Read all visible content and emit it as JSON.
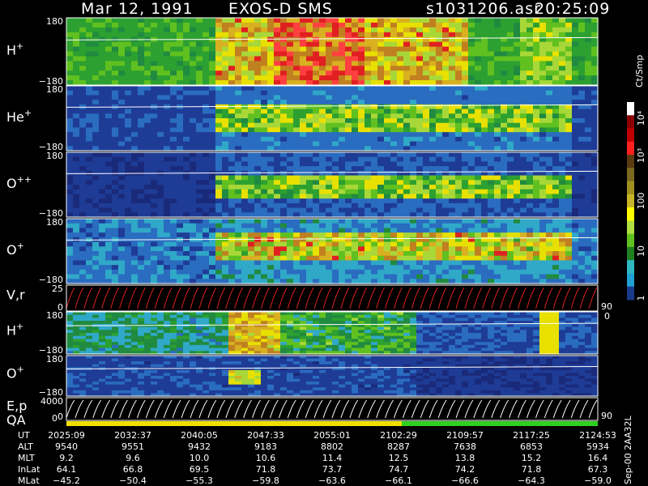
{
  "header": {
    "date": "Mar 12, 1991",
    "mission": "EXOS-D SMS",
    "file": "s1031206.asr",
    "time": "20:25:09"
  },
  "colorbar": {
    "unit": "Ct/Smp",
    "tick_labels": [
      "10⁴",
      "10³",
      "100",
      "10",
      "1"
    ],
    "colors": [
      "#ffffff",
      "#8b0000",
      "#c00000",
      "#ff2020",
      "#5a3a10",
      "#7a6a20",
      "#a09020",
      "#c8b428",
      "#ffff00",
      "#b0e040",
      "#60c020",
      "#208020",
      "#30b8c0",
      "#20a0d0",
      "#1a3a8a"
    ]
  },
  "panels": [
    {
      "id": "H+",
      "base": "H",
      "sup": "+",
      "ytop": "180",
      "ybot": "−180",
      "kind": "spec"
    },
    {
      "id": "He+",
      "base": "He",
      "sup": "+",
      "ytop": "180",
      "ybot": "−180",
      "kind": "spec"
    },
    {
      "id": "O++",
      "base": "O",
      "sup": "++",
      "ytop": "180",
      "ybot": "−180",
      "kind": "spec"
    },
    {
      "id": "O+",
      "base": "O",
      "sup": "+",
      "ytop": "180",
      "ybot": "−180",
      "kind": "spec"
    },
    {
      "id": "Vr",
      "base": "V,r",
      "sup": "",
      "ytop": "25",
      "ybot": "0",
      "kind": "line",
      "right_top": "90",
      "right_bot": "0"
    },
    {
      "id": "H+2",
      "base": "H",
      "sup": "+",
      "ytop": "180",
      "ybot": "−180",
      "kind": "spec"
    },
    {
      "id": "O+2",
      "base": "O",
      "sup": "+",
      "ytop": "180",
      "ybot": "−180",
      "kind": "spec"
    },
    {
      "id": "Ep",
      "base": "E,p",
      "sup": "",
      "ytop": "4000",
      "ybot": "0",
      "kind": "line",
      "right_top": "90",
      "right_bot": ""
    }
  ],
  "qa_label": "QA",
  "ephemeris": {
    "rows": [
      {
        "name": "UT",
        "values": [
          "2025:09",
          "2032:37",
          "2040:05",
          "2047:33",
          "2055:01",
          "2102:29",
          "2109:57",
          "2117:25",
          "2124:53"
        ]
      },
      {
        "name": "ALT",
        "values": [
          "9540",
          "9551",
          "9432",
          "9183",
          "8802",
          "8287",
          "7638",
          "6853",
          "5934"
        ]
      },
      {
        "name": "MLT",
        "values": [
          "9.2",
          "9.6",
          "10.0",
          "10.6",
          "11.4",
          "12.5",
          "13.8",
          "15.2",
          "16.4"
        ]
      },
      {
        "name": "InLat",
        "values": [
          "64.1",
          "66.8",
          "69.5",
          "71.8",
          "73.7",
          "74.7",
          "74.2",
          "71.8",
          "67.3"
        ]
      },
      {
        "name": "MLat",
        "values": [
          "−45.2",
          "−50.4",
          "−55.3",
          "−59.8",
          "−63.6",
          "−66.1",
          "−66.6",
          "−64.3",
          "−59.0"
        ]
      }
    ]
  },
  "footer_note": "Sep-00 2AA32L",
  "chart_data": {
    "type": "heatmap",
    "title": "Mar 12, 1991   EXOS-D SMS",
    "x_ticks_UT": [
      "2025:09",
      "2032:37",
      "2040:05",
      "2047:33",
      "2055:01",
      "2102:29",
      "2109:57",
      "2117:25",
      "2124:53"
    ],
    "y_range_spectra": [
      -180,
      180
    ],
    "colorbar_range": [
      1,
      10000
    ],
    "colorbar_scale": "log",
    "colorbar_unit": "Ct/Smp",
    "panels": [
      "H+",
      "He+",
      "O++",
      "O+",
      "V,r",
      "H+",
      "O+",
      "E,p"
    ]
  }
}
